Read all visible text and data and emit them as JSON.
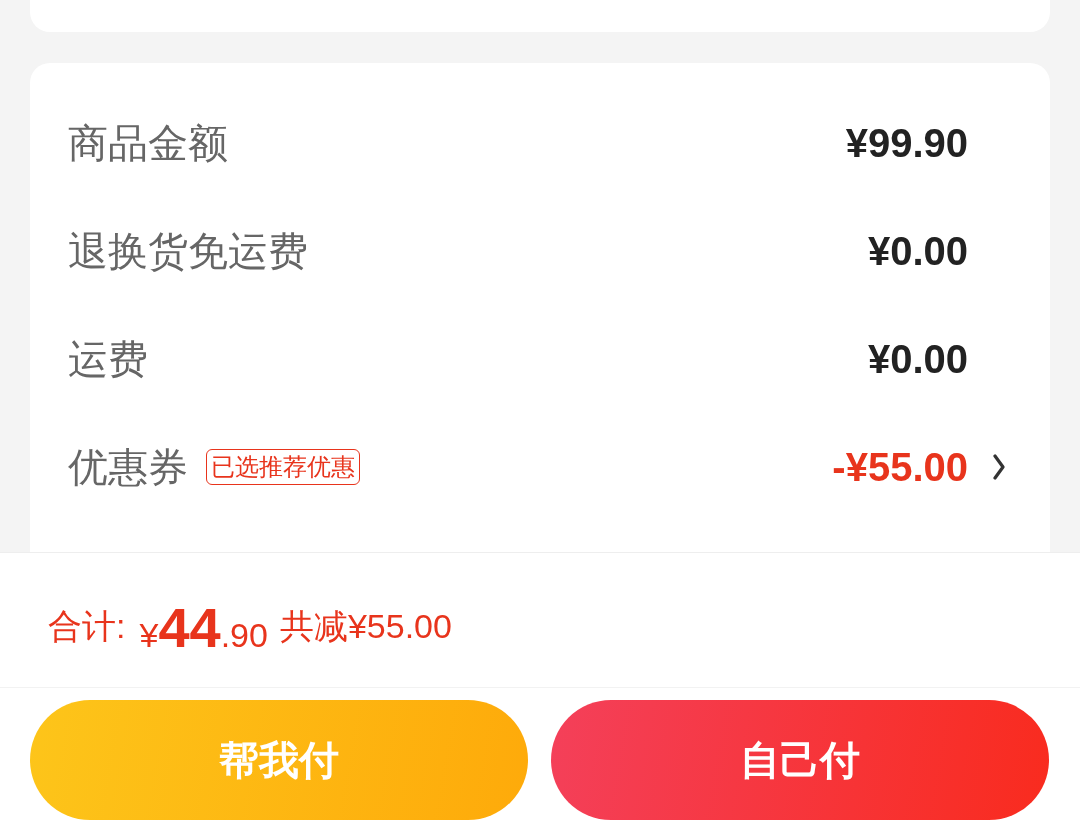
{
  "fees": [
    {
      "kind": "plain",
      "label": "商品金额",
      "value": "¥99.90"
    },
    {
      "kind": "plain",
      "label": "退换货免运费",
      "value": "¥0.00"
    },
    {
      "kind": "plain",
      "label": "运费",
      "value": "¥0.00"
    },
    {
      "kind": "coupon",
      "label": "优惠券",
      "tag": "已选推荐优惠",
      "value": "-¥55.00"
    }
  ],
  "total": {
    "label": "合计:",
    "currency": "¥",
    "integer": "44",
    "decimal": ".90",
    "saved": "共减¥55.00"
  },
  "buttons": [
    {
      "kind": "helper",
      "label": "帮我付"
    },
    {
      "kind": "self",
      "label": "自己付"
    }
  ]
}
